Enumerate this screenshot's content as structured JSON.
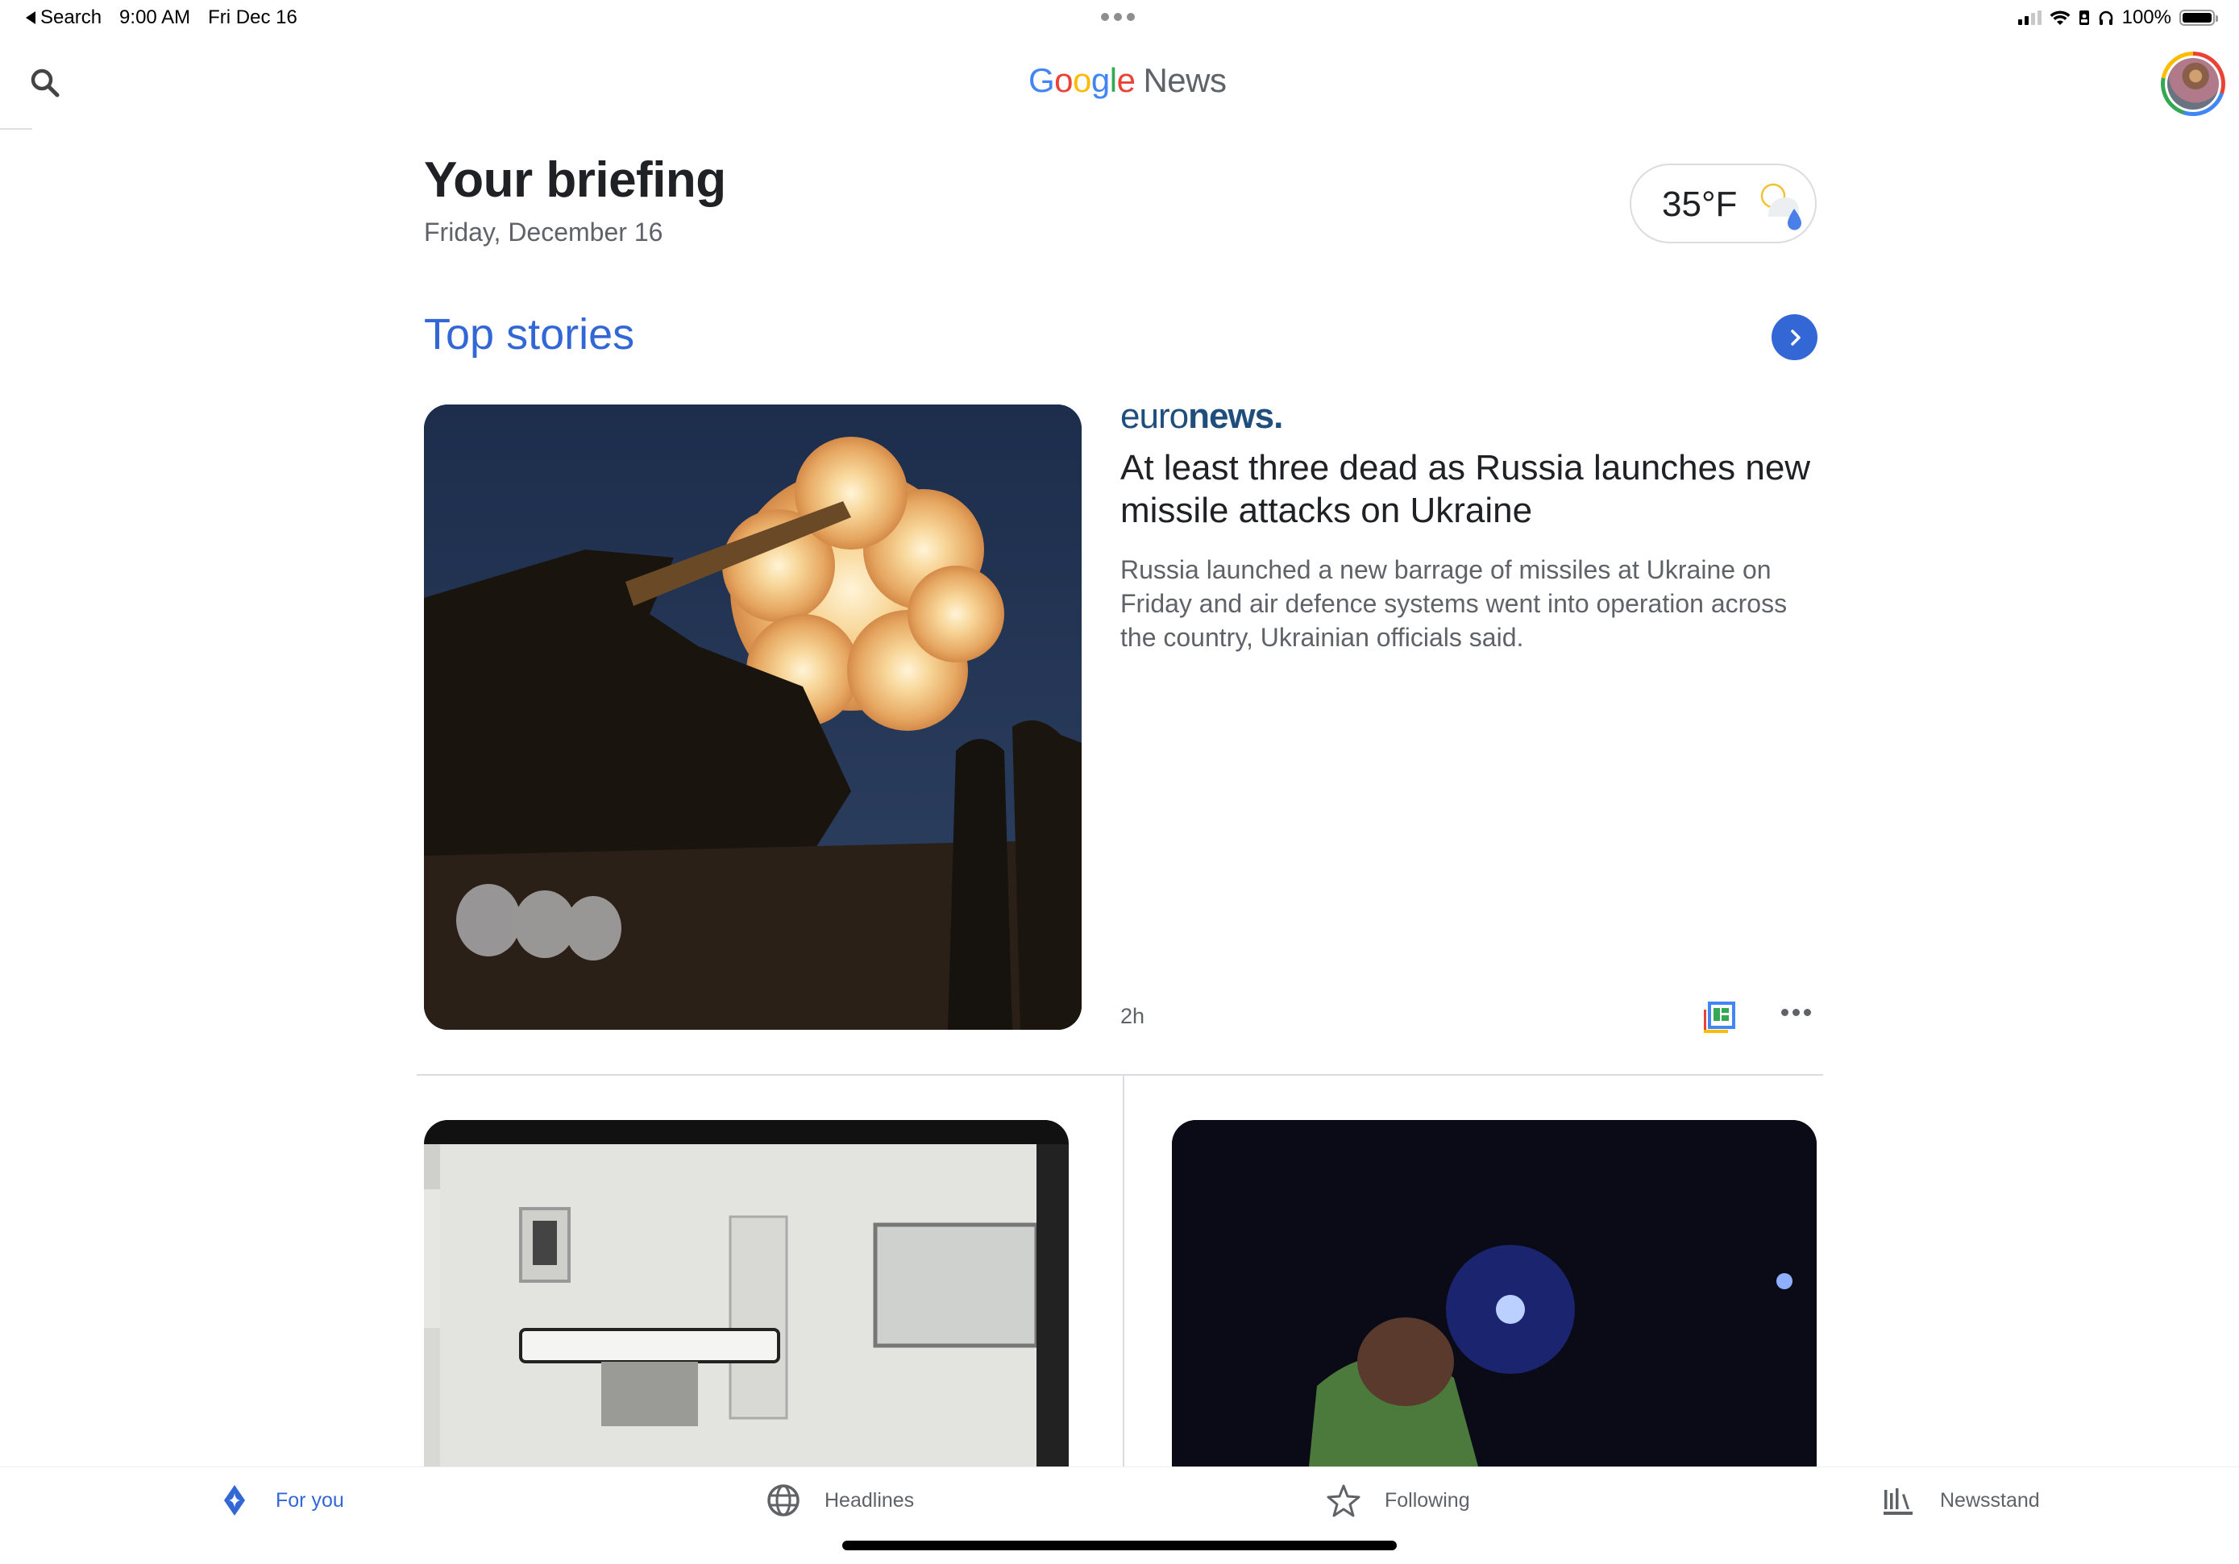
{
  "status_bar": {
    "back_label": "Search",
    "time": "9:00 AM",
    "date": "Fri Dec 16",
    "battery": "100%",
    "battery_level": 1.0,
    "signal_bars_on": 2,
    "signal_bars_total": 4
  },
  "header": {
    "logo_letters": [
      "G",
      "o",
      "o",
      "g",
      "l",
      "e"
    ],
    "logo_product": "News",
    "search_icon": "search-icon",
    "avatar_icon": "account-avatar"
  },
  "briefing": {
    "title": "Your briefing",
    "date": "Friday, December 16",
    "weather": {
      "temperature": "35°F",
      "condition_icon": "partly-sunny-rain-icon"
    }
  },
  "top_stories": {
    "title": "Top stories",
    "more_icon": "chevron-right-icon",
    "main_story": {
      "source_light": "euro",
      "source_bold": "news",
      "source_dot": ".",
      "headline": "At least three dead as Russia launches new missile attacks on Ukraine",
      "description": "Russia launched a new barrage of missiles at Ukraine on Friday and air defence systems went into operation across the country, Ukrainian officials said.",
      "age": "2h",
      "image_alt": "Artillery firing at night",
      "full_coverage_icon": "full-coverage-icon",
      "more_icon": "more-horizontal-icon"
    },
    "secondary_stories": [
      {
        "image_alt": "Execution chamber room"
      },
      {
        "image_alt": "Man under flashlight at night"
      }
    ]
  },
  "tabbar": {
    "tabs": [
      {
        "label": "For you",
        "icon": "for-you-icon",
        "active": true
      },
      {
        "label": "Headlines",
        "icon": "globe-icon",
        "active": false
      },
      {
        "label": "Following",
        "icon": "star-icon",
        "active": false
      },
      {
        "label": "Newsstand",
        "icon": "newsstand-icon",
        "active": false
      }
    ]
  },
  "colors": {
    "accent": "#3367d6",
    "text_primary": "#202124",
    "text_secondary": "#5f6368",
    "divider": "#dadce0",
    "google_blue": "#4285f4",
    "google_red": "#ea4335",
    "google_yellow": "#fbbc05",
    "google_green": "#34a853",
    "euronews_blue": "#1f4e7d"
  }
}
